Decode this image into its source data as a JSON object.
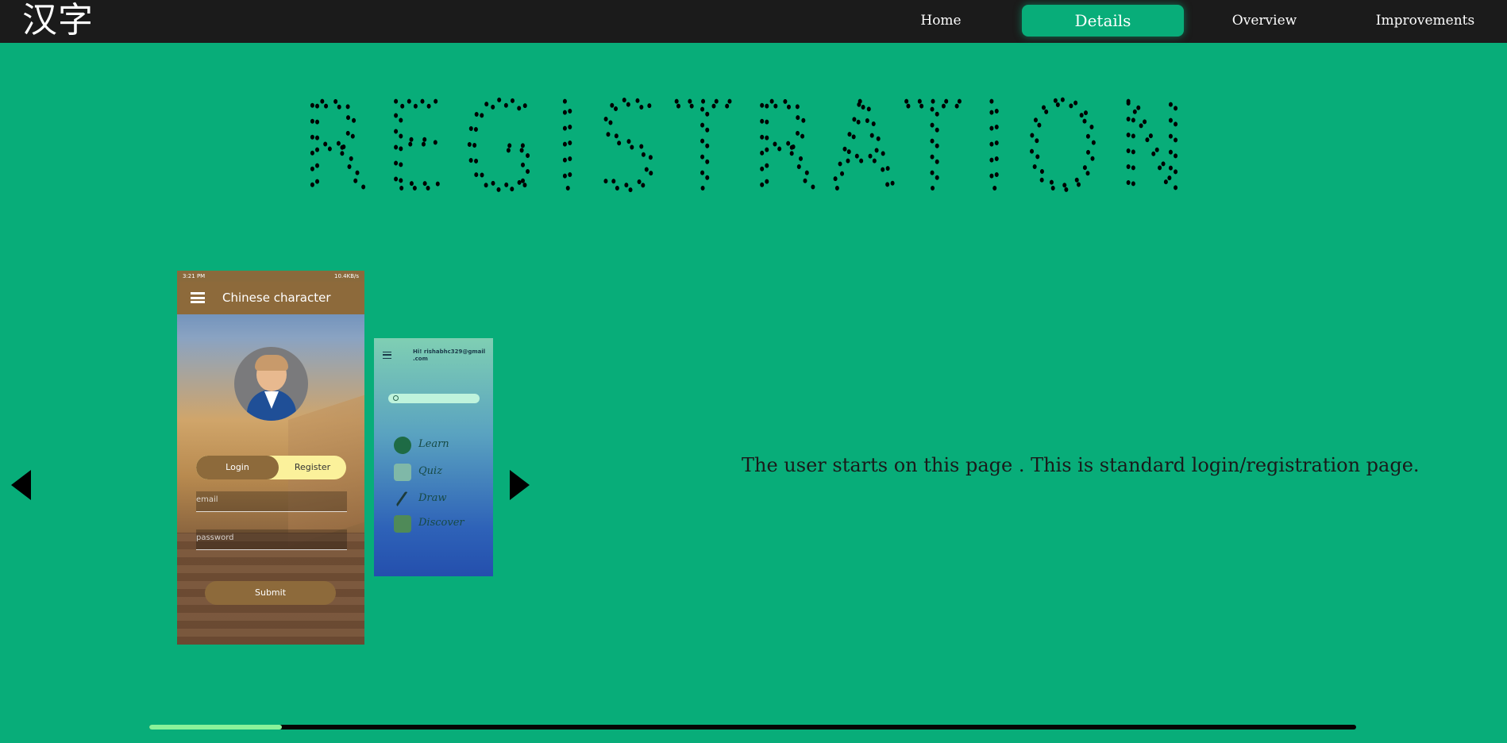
{
  "nav": {
    "logo": "汉字",
    "items": [
      {
        "label": "Home",
        "active": false
      },
      {
        "label": "Details",
        "active": true
      },
      {
        "label": "Overview",
        "active": false
      },
      {
        "label": "Improvements",
        "active": false
      }
    ]
  },
  "hero": {
    "title": "REGISTRATION"
  },
  "carousel": {
    "prev_icon": "caret-left-icon",
    "next_icon": "caret-right-icon",
    "screenshots": [
      {
        "status_time": "3:21 PM",
        "status_right": "10.4KB/s",
        "app_title": "Chinese character",
        "tabs": [
          "Login",
          "Register"
        ],
        "email_placeholder": "email",
        "password_placeholder": "password",
        "submit_label": "Submit"
      },
      {
        "greeting": "Hi! rishabhc329@gmail .com",
        "menu_items": [
          "Learn",
          "Quiz",
          "Draw",
          "Discover"
        ]
      }
    ]
  },
  "description": "The user starts on this page . This is standard login/registration page.",
  "progress": {
    "fraction": 0.11
  },
  "colors": {
    "background": "#08ad79",
    "topbar": "#1b1b1b",
    "progress_fill": "#8af29a",
    "progress_track": "#050505"
  }
}
